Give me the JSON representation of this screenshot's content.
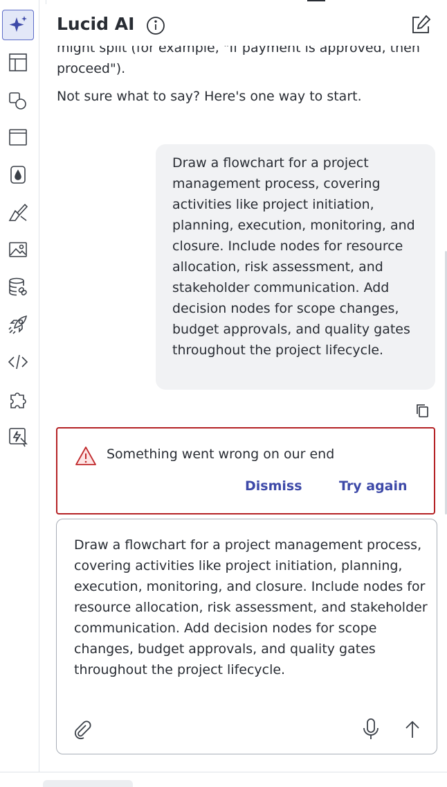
{
  "panel": {
    "title": "Lucid AI"
  },
  "rail": {
    "items": [
      {
        "icon": "sparkle-icon",
        "active": true
      },
      {
        "icon": "layout-icon"
      },
      {
        "icon": "shapes-icon"
      },
      {
        "icon": "window-icon"
      },
      {
        "icon": "fill-drop-icon"
      },
      {
        "icon": "brush-icon"
      },
      {
        "icon": "image-icon"
      },
      {
        "icon": "data-link-icon"
      },
      {
        "icon": "rocket-icon"
      },
      {
        "icon": "code-icon"
      },
      {
        "icon": "puzzle-icon"
      },
      {
        "icon": "quick-action-icon"
      }
    ]
  },
  "chat": {
    "intro_cut_line_1": "might split (for example, \"If payment is approved, then",
    "intro_cut_line_2": "proceed\").",
    "intro_start": "Not sure what to say? Here's one way to start.",
    "user_message": "Draw a flowchart for a project management process, covering activities like project initiation, planning, execution, monitoring, and closure. Include nodes for resource allocation, risk assessment, and stakeholder communication. Add decision nodes for scope changes, budget approvals, and quality gates throughout the project lifecycle."
  },
  "error": {
    "message": "Something went wrong on our end",
    "dismiss_label": "Dismiss",
    "retry_label": "Try again"
  },
  "composer": {
    "value": "Draw a flowchart for a project management process, covering activities like project initiation, planning, execution, monitoring, and closure. Include nodes for resource allocation, risk assessment, and stakeholder communication. Add decision nodes for scope changes, budget approvals, and quality gates throughout the project lifecycle."
  },
  "colors": {
    "accent": "#3d49a8",
    "error_border": "#b42124",
    "active_rail": "#e3e8f8"
  }
}
